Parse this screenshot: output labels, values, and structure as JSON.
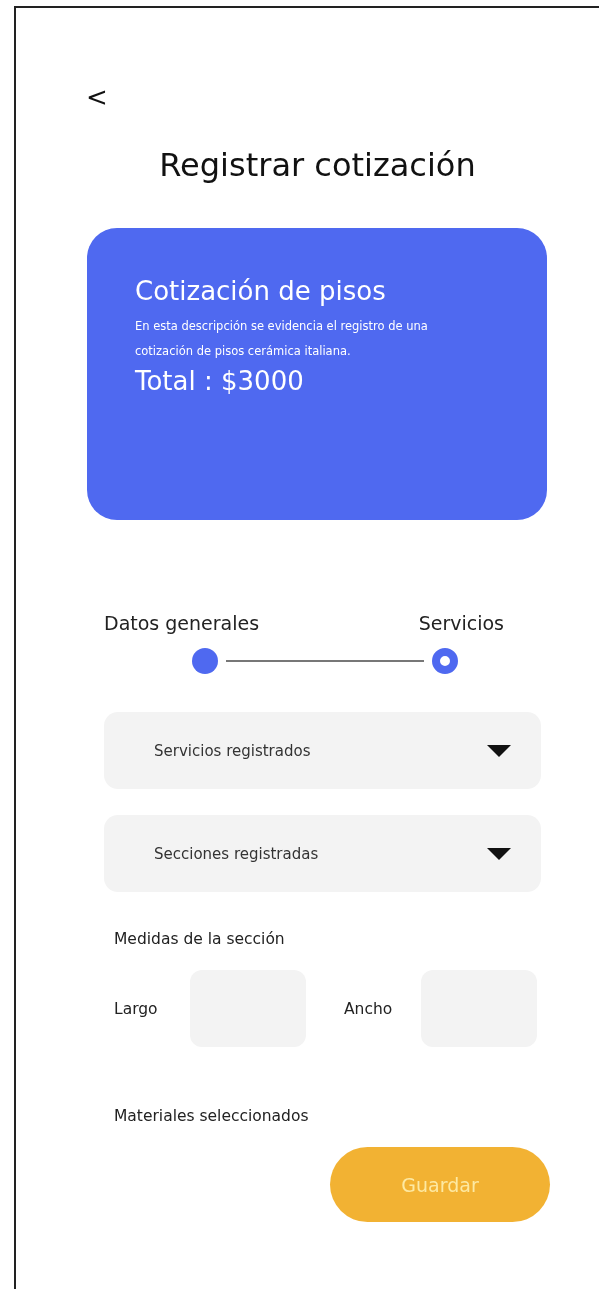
{
  "back_button": {
    "label": "<"
  },
  "title": "Registrar cotización",
  "summary_card": {
    "title": "Cotización de pisos",
    "description": "En esta descripción se evidencia el registro de una cotización de pisos cerámica italiana.",
    "total": "Total : $3000"
  },
  "steps": [
    {
      "label": "Datos generales",
      "current": false
    },
    {
      "label": "Servicios",
      "current": true
    }
  ],
  "dropdowns": [
    {
      "placeholder": "Servicios registrados"
    },
    {
      "placeholder": "Secciones registradas"
    }
  ],
  "measures": {
    "heading": "Medidas de la sección",
    "fields": [
      {
        "label": "Largo"
      },
      {
        "label": "Ancho"
      }
    ]
  },
  "materials_heading": "Materiales seleccionados",
  "save_button": {
    "label": "Guardar"
  }
}
